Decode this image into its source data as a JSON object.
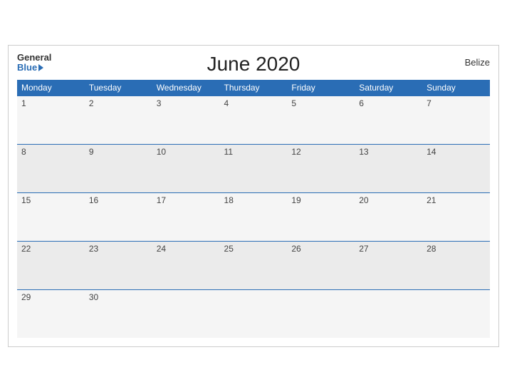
{
  "header": {
    "title": "June 2020",
    "brand_general": "General",
    "brand_blue": "Blue",
    "country": "Belize"
  },
  "weekdays": [
    "Monday",
    "Tuesday",
    "Wednesday",
    "Thursday",
    "Friday",
    "Saturday",
    "Sunday"
  ],
  "weeks": [
    [
      "1",
      "2",
      "3",
      "4",
      "5",
      "6",
      "7"
    ],
    [
      "8",
      "9",
      "10",
      "11",
      "12",
      "13",
      "14"
    ],
    [
      "15",
      "16",
      "17",
      "18",
      "19",
      "20",
      "21"
    ],
    [
      "22",
      "23",
      "24",
      "25",
      "26",
      "27",
      "28"
    ],
    [
      "29",
      "30",
      "",
      "",
      "",
      "",
      ""
    ]
  ]
}
